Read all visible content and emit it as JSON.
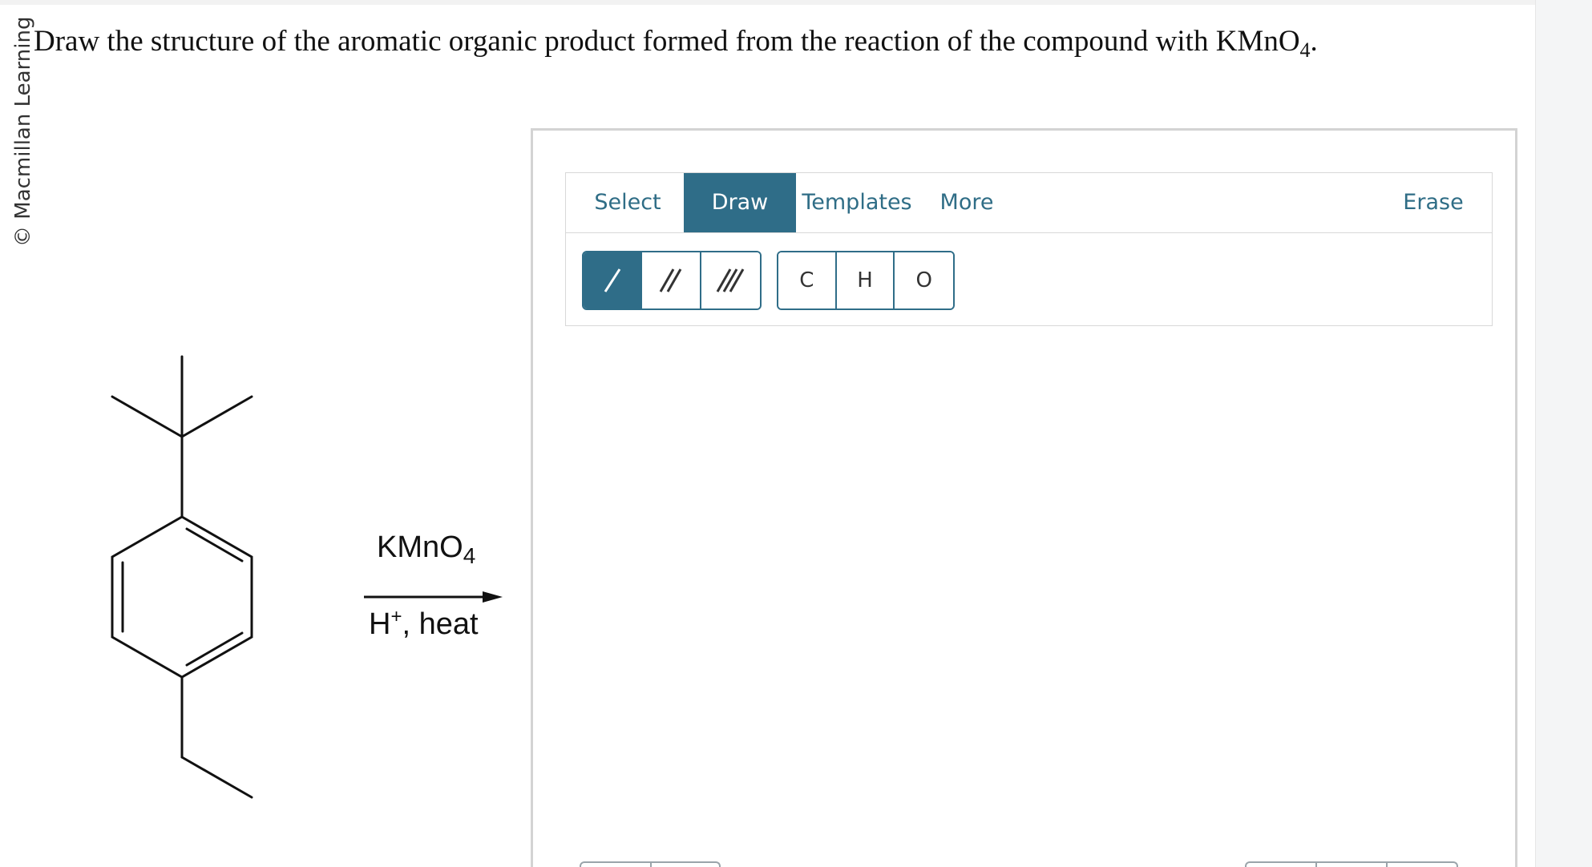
{
  "copyright": "© Macmillan Learning",
  "question": {
    "text": "Draw the structure of the aromatic organic product formed from the reaction of the compound with KMnO",
    "subscript": "4",
    "end": "."
  },
  "reaction": {
    "reagent_top": "KMnO",
    "reagent_top_sub": "4",
    "reagent_bottom_pre": "H",
    "reagent_bottom_sup": "+",
    "reagent_bottom_post": ", heat"
  },
  "toolbar": {
    "tabs": [
      {
        "label": "Select",
        "active": false
      },
      {
        "label": "Draw",
        "active": true
      },
      {
        "label": "Templates",
        "active": false
      },
      {
        "label": "More",
        "active": false
      }
    ],
    "erase_label": "Erase",
    "bond_buttons": [
      {
        "name": "single-bond",
        "active": true
      },
      {
        "name": "double-bond",
        "active": false
      },
      {
        "name": "triple-bond",
        "active": false
      }
    ],
    "atoms": [
      "C",
      "H",
      "O"
    ]
  },
  "colors": {
    "accent": "#2f6d88",
    "text": "#111111",
    "border": "#d3d3d3"
  }
}
